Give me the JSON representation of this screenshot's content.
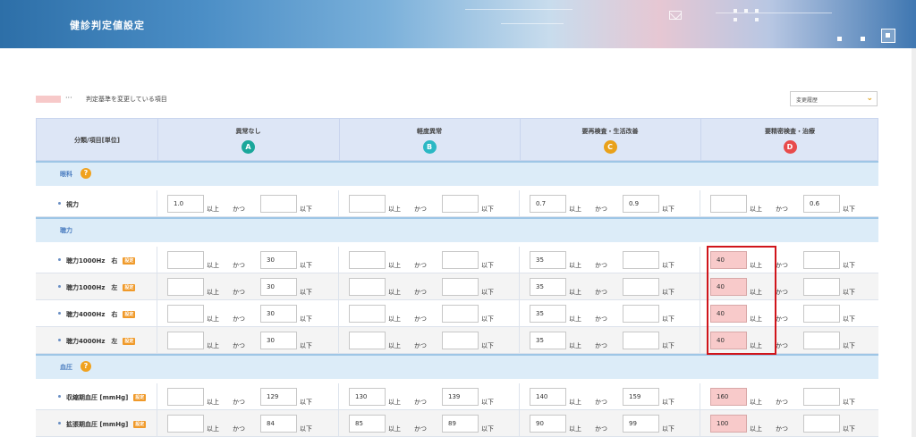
{
  "header": {
    "title": "健診判定値設定"
  },
  "legend": {
    "dots": "···",
    "text": "判定基準を変更している項目"
  },
  "history_select": {
    "value": "変更履歴"
  },
  "table": {
    "category_header": "分類/項目[単位]",
    "grade_columns": [
      {
        "label": "異常なし",
        "badge": "A",
        "color": "#1aa79b"
      },
      {
        "label": "軽度異常",
        "badge": "B",
        "color": "#2bb8c4"
      },
      {
        "label": "要再検査・生活改善",
        "badge": "C",
        "color": "#e9a11a"
      },
      {
        "label": "要精密検査・治療",
        "badge": "D",
        "color": "#e84b4b"
      }
    ],
    "words": {
      "ge": "以上",
      "and": "かつ",
      "le": "以下"
    },
    "tag_label": "設定",
    "sections": [
      {
        "label": "眼科",
        "help": "?",
        "rows": [
          {
            "label": "視力",
            "tag": false,
            "cells": [
              [
                "1.0",
                ""
              ],
              [
                "",
                ""
              ],
              [
                "0.7",
                "0.9"
              ],
              [
                "",
                "0.6"
              ]
            ]
          }
        ]
      },
      {
        "label": "聴力",
        "help": "",
        "rows": [
          {
            "label": "聴力1000Hz　右",
            "tag": true,
            "cells": [
              [
                "",
                "30"
              ],
              [
                "",
                ""
              ],
              [
                "35",
                ""
              ],
              [
                "40",
                ""
              ]
            ]
          },
          {
            "label": "聴力1000Hz　左",
            "tag": true,
            "cells": [
              [
                "",
                "30"
              ],
              [
                "",
                ""
              ],
              [
                "35",
                ""
              ],
              [
                "40",
                ""
              ]
            ]
          },
          {
            "label": "聴力4000Hz　右",
            "tag": true,
            "cells": [
              [
                "",
                "30"
              ],
              [
                "",
                ""
              ],
              [
                "35",
                ""
              ],
              [
                "40",
                ""
              ]
            ]
          },
          {
            "label": "聴力4000Hz　左",
            "tag": true,
            "cells": [
              [
                "",
                "30"
              ],
              [
                "",
                ""
              ],
              [
                "35",
                ""
              ],
              [
                "40",
                ""
              ]
            ]
          }
        ]
      },
      {
        "label": "血圧",
        "help": "?",
        "rows": [
          {
            "label": "収縮期血圧 [mmHg]",
            "tag": true,
            "cells": [
              [
                "",
                "129"
              ],
              [
                "130",
                "139"
              ],
              [
                "140",
                "159"
              ],
              [
                "160",
                ""
              ]
            ]
          },
          {
            "label": "拡張期血圧 [mmHg]",
            "tag": true,
            "cells": [
              [
                "",
                "84"
              ],
              [
                "85",
                "89"
              ],
              [
                "90",
                "99"
              ],
              [
                "100",
                ""
              ]
            ]
          }
        ]
      }
    ]
  },
  "highlight": {
    "column_index": 3,
    "color": "#f8caca",
    "frame_color": "#d0151b"
  }
}
